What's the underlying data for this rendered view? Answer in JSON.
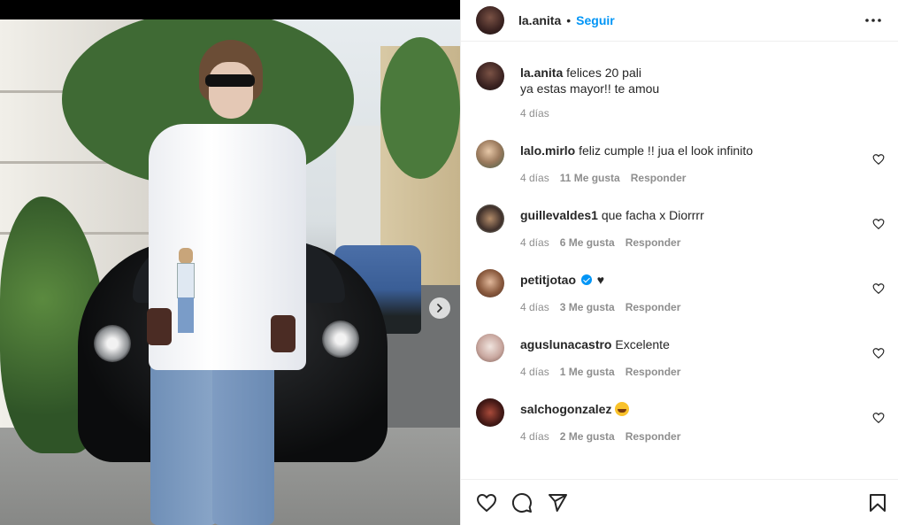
{
  "post": {
    "username": "la.anita",
    "separator": "•",
    "follow_label": "Seguir",
    "more_icon": "more-horizontal-icon"
  },
  "caption": {
    "username": "la.anita",
    "text": "felices 20 pali\nya estas mayor!! te amou",
    "time": "4 días"
  },
  "comments": [
    {
      "username": "lalo.mirlo",
      "text": "feliz cumple !! jua el look infinito",
      "time": "4 días",
      "likes": "11 Me gusta",
      "reply": "Responder",
      "verified": false,
      "emoji": null
    },
    {
      "username": "guillevaldes1",
      "text": "que facha x Diorrrr",
      "time": "4 días",
      "likes": "6 Me gusta",
      "reply": "Responder",
      "verified": false,
      "emoji": null
    },
    {
      "username": "petitjotao",
      "text": "♥",
      "time": "4 días",
      "likes": "3 Me gusta",
      "reply": "Responder",
      "verified": true,
      "emoji": null
    },
    {
      "username": "aguslunacastro",
      "text": "Excelente",
      "time": "4 días",
      "likes": "1 Me gusta",
      "reply": "Responder",
      "verified": false,
      "emoji": null
    },
    {
      "username": "salchogonzalez",
      "text": "",
      "time": "4 días",
      "likes": "2 Me gusta",
      "reply": "Responder",
      "verified": false,
      "emoji": "grinning-squinting-face"
    }
  ],
  "actions": {
    "icons": [
      "heart-icon",
      "comment-icon",
      "share-icon",
      "bookmark-icon"
    ]
  },
  "colors": {
    "link_blue": "#0095f6",
    "text": "#262626",
    "muted": "#8e8e8e",
    "border": "#efefef"
  }
}
